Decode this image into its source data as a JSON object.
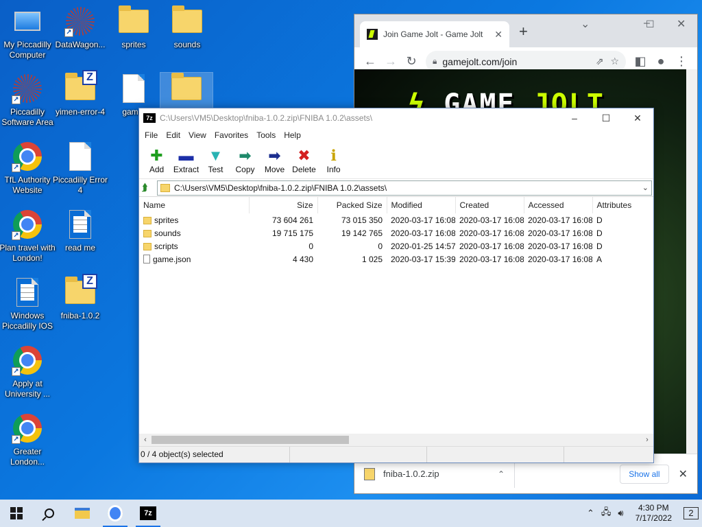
{
  "desktop": {
    "icons": [
      {
        "label": "My Piccadilly Computer",
        "icon": "computer-icon"
      },
      {
        "label": "DataWagon...",
        "icon": "burst-icon"
      },
      {
        "label": "sprites",
        "icon": "folder-icon"
      },
      {
        "label": "sounds",
        "icon": "folder-icon"
      },
      {
        "label": "Piccadilly Software Area",
        "icon": "burst-icon"
      },
      {
        "label": "yimen-error-4",
        "icon": "zip-folder-icon"
      },
      {
        "label": "game.",
        "icon": "document-icon"
      },
      {
        "label": "",
        "icon": "folder-icon"
      },
      {
        "label": "TfL Authority Website",
        "icon": "chrome-icon"
      },
      {
        "label": "Piccadilly Error 4",
        "icon": "document-icon"
      },
      {
        "label": "Plan travel with London!",
        "icon": "chrome-icon"
      },
      {
        "label": "read me",
        "icon": "text-document-icon"
      },
      {
        "label": "Windows Piccadilly IOS",
        "icon": "text-document-icon"
      },
      {
        "label": "fniba-1.0.2",
        "icon": "zip-folder-icon"
      },
      {
        "label": "Apply at University ...",
        "icon": "chrome-icon"
      },
      {
        "label": "Greater London...",
        "icon": "chrome-icon"
      }
    ]
  },
  "chrome": {
    "tab_title": "Join Game Jolt - Game Jolt",
    "url": "gamejolt.com/join",
    "logo_left": "GAME",
    "logo_right": "JOLT",
    "download_filename": "fniba-1.0.2.zip",
    "show_all": "Show all"
  },
  "sevenzip": {
    "title": "C:\\Users\\VM5\\Desktop\\fniba-1.0.2.zip\\FNIBA 1.0.2\\assets\\",
    "app_badge": "7z",
    "menu": [
      "File",
      "Edit",
      "View",
      "Favorites",
      "Tools",
      "Help"
    ],
    "toolbar": [
      {
        "label": "Add",
        "glyph": "✚",
        "color": "#1e9e1e"
      },
      {
        "label": "Extract",
        "glyph": "▬",
        "color": "#1c2fa8"
      },
      {
        "label": "Test",
        "glyph": "▼",
        "color": "#29b3b3"
      },
      {
        "label": "Copy",
        "glyph": "➡",
        "color": "#1f8a6b"
      },
      {
        "label": "Move",
        "glyph": "➡",
        "color": "#1c2f8f"
      },
      {
        "label": "Delete",
        "glyph": "✖",
        "color": "#d42020"
      },
      {
        "label": "Info",
        "glyph": "ℹ",
        "color": "#c9a400"
      }
    ],
    "address": "C:\\Users\\VM5\\Desktop\\fniba-1.0.2.zip\\FNIBA 1.0.2\\assets\\",
    "columns": [
      "Name",
      "Size",
      "Packed Size",
      "Modified",
      "Created",
      "Accessed",
      "Attributes"
    ],
    "rows": [
      {
        "type": "folder",
        "name": "sprites",
        "size": "73 604 261",
        "packed": "73 015 350",
        "modified": "2020-03-17 16:08",
        "created": "2020-03-17 16:08",
        "accessed": "2020-03-17 16:08",
        "attr": "D"
      },
      {
        "type": "folder",
        "name": "sounds",
        "size": "19 715 175",
        "packed": "19 142 765",
        "modified": "2020-03-17 16:08",
        "created": "2020-03-17 16:08",
        "accessed": "2020-03-17 16:08",
        "attr": "D"
      },
      {
        "type": "folder",
        "name": "scripts",
        "size": "0",
        "packed": "0",
        "modified": "2020-01-25 14:57",
        "created": "2020-03-17 16:08",
        "accessed": "2020-03-17 16:08",
        "attr": "D"
      },
      {
        "type": "file",
        "name": "game.json",
        "size": "4 430",
        "packed": "1 025",
        "modified": "2020-03-17 15:39",
        "created": "2020-03-17 16:08",
        "accessed": "2020-03-17 16:08",
        "attr": "A"
      }
    ],
    "status": "0 / 4 object(s) selected"
  },
  "taskbar": {
    "time": "4:30 PM",
    "date": "7/17/2022",
    "notifications": "2"
  }
}
